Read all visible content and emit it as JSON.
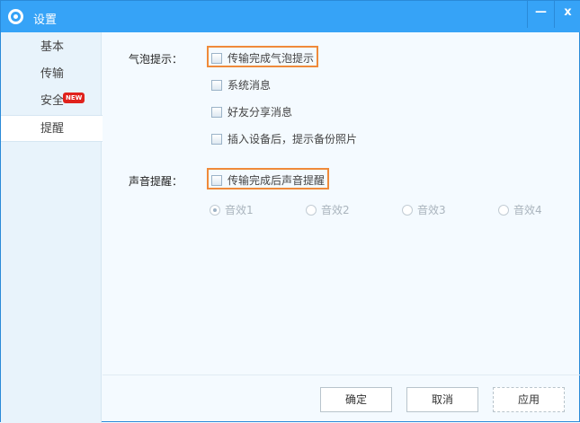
{
  "window": {
    "title": "设置",
    "minimize": "—",
    "close": "x"
  },
  "sidebar": {
    "items": [
      {
        "label": "基本"
      },
      {
        "label": "传输"
      },
      {
        "label": "安全",
        "badge": "NEW"
      },
      {
        "label": "提醒"
      }
    ]
  },
  "bubble": {
    "label": "气泡提示：",
    "options": [
      "传输完成气泡提示",
      "系统消息",
      "好友分享消息",
      "插入设备后，提示备份照片"
    ]
  },
  "sound": {
    "label": "声音提醒：",
    "option": "传输完成后声音提醒",
    "effects": [
      "音效1",
      "音效2",
      "音效3",
      "音效4"
    ]
  },
  "buttons": {
    "ok": "确定",
    "cancel": "取消",
    "apply": "应用"
  },
  "colors": {
    "titlebar": "#36a3f7",
    "highlight": "#ef8a3a",
    "badge": "#e0221c"
  }
}
